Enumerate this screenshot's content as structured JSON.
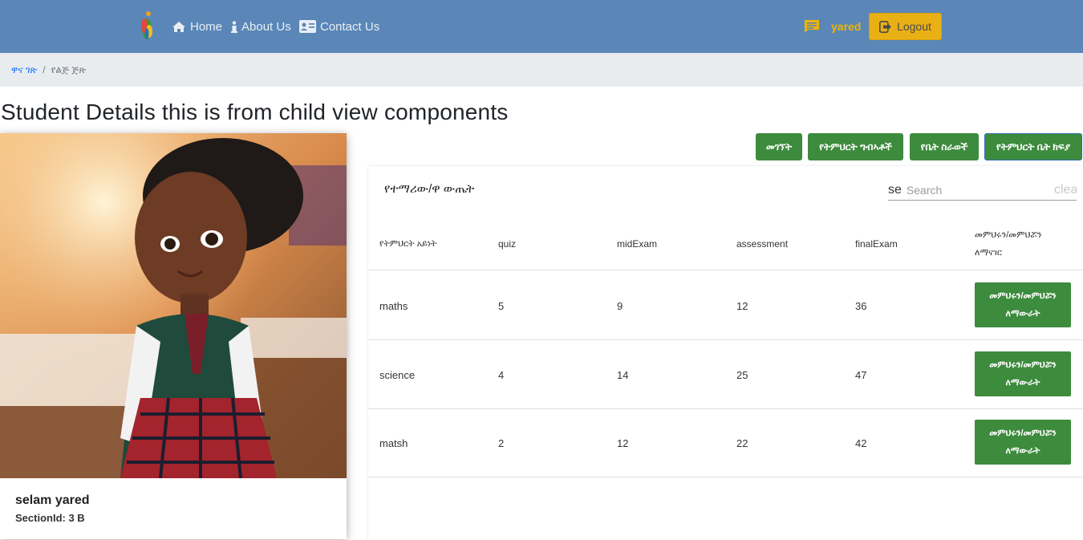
{
  "nav": {
    "home": "Home",
    "about": "About Us",
    "contact": "Contact Us",
    "user": "yared",
    "logout": "Logout"
  },
  "breadcrumb": {
    "home": "ዋና ገጽ",
    "separator": "/",
    "current": "የልጅ ጅጽ"
  },
  "page_title": "Student Details this is from child view components",
  "student": {
    "name": "selam yared",
    "section": "SectionId: 3 B"
  },
  "actions": [
    "መገኘት",
    "የትምህርት ግብኣቶች",
    "የቤት ስራወች",
    "የትምህርት ቤት ክፍያ"
  ],
  "results": {
    "title": "የተማሪው/ዋ ውጤት",
    "search_prefix": "se",
    "search_placeholder": "Search",
    "clear_text": "clear",
    "columns": [
      "የትምህርት አይነት",
      "quiz",
      "midExam",
      "assessment",
      "finalExam",
      "መምህሩን/መምህሯን ለማናገር"
    ],
    "rows": [
      {
        "subject": "maths",
        "quiz": "5",
        "midExam": "9",
        "assessment": "12",
        "finalExam": "36",
        "action": "መምህሩን/መምህሯን ለማውራት"
      },
      {
        "subject": "science",
        "quiz": "4",
        "midExam": "14",
        "assessment": "25",
        "finalExam": "47",
        "action": "መምህሩን/መምህሯን ለማውራት"
      },
      {
        "subject": "matsh",
        "quiz": "2",
        "midExam": "12",
        "assessment": "22",
        "finalExam": "42",
        "action": "መምህሩን/መምህሯን ለማውራት"
      }
    ]
  },
  "colors": {
    "navbar": "#5a87b8",
    "logout": "#e9b015",
    "green": "#3d8b3d",
    "breadcrumb_bg": "#e9ecef",
    "link": "#0d6efd"
  },
  "icons": [
    "logo-icon",
    "home-icon",
    "info-icon",
    "contact-card-icon",
    "message-icon",
    "logout-icon"
  ]
}
